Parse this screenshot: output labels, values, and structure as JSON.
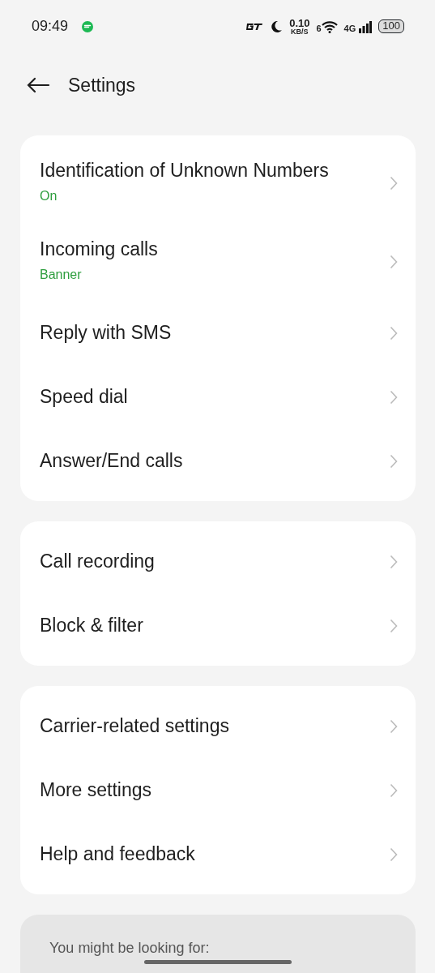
{
  "status_bar": {
    "time": "09:49",
    "network_speed": "0.10",
    "speed_unit": "KB/S",
    "wifi_label": "6",
    "network_type": "4G",
    "battery": "100"
  },
  "header": {
    "title": "Settings"
  },
  "sections": [
    {
      "items": [
        {
          "title": "Identification of Unknown Numbers",
          "value": "On"
        },
        {
          "title": "Incoming calls",
          "value": "Banner"
        },
        {
          "title": "Reply with SMS"
        },
        {
          "title": "Speed dial"
        },
        {
          "title": "Answer/End calls"
        }
      ]
    },
    {
      "items": [
        {
          "title": "Call recording"
        },
        {
          "title": "Block & filter"
        }
      ]
    },
    {
      "items": [
        {
          "title": "Carrier-related settings"
        },
        {
          "title": "More settings"
        },
        {
          "title": "Help and feedback"
        }
      ]
    }
  ],
  "suggestions": {
    "title": "You might be looking for:"
  }
}
